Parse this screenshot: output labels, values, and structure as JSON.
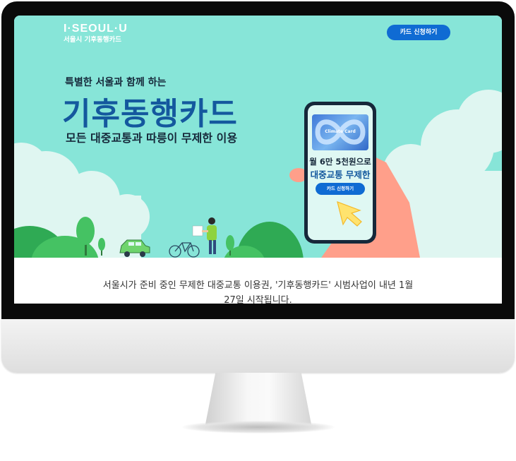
{
  "header": {
    "logo_main": "I·SEOUL·U",
    "logo_sub": "서울시 기후동행카드",
    "apply_button": "카드 신청하기"
  },
  "hero": {
    "eyebrow": "특별한 서울과 함께 하는",
    "title": "기후동행카드",
    "subtitle": "모든 대중교통과 따릉이 무제한 이용",
    "background": "#87e5d8",
    "accent": "#14589e"
  },
  "phone": {
    "price_text": "월 6만 5천원으로",
    "unlimited_text": "대중교통 무제한",
    "button_label": "카드 신청하기",
    "card_label": "Climate Card"
  },
  "article": {
    "line1": "서울시가 준비 중인 무제한 대중교통 이용권, '기후동행카드' 시범사업이 내년 1월",
    "line2": "27일 시작됩니다."
  },
  "icons": [
    "tree-icon",
    "car-icon",
    "bicycle-icon",
    "person-icon",
    "cursor-arrow-icon",
    "hand-icon"
  ]
}
